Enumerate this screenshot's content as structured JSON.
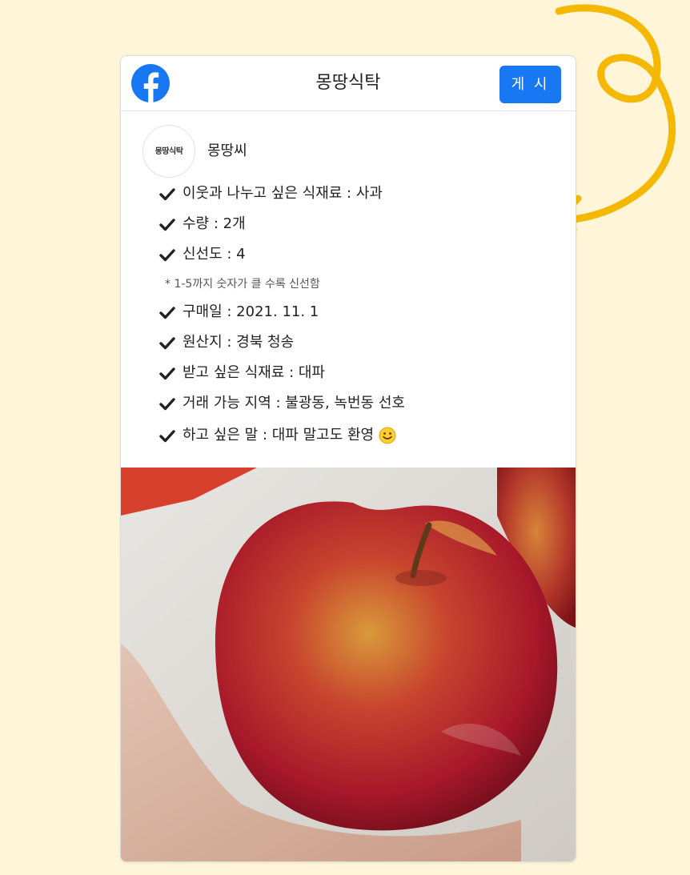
{
  "header": {
    "title": "몽땅식탁",
    "post_button_label": "게 시",
    "logo_icon": "facebook-icon"
  },
  "profile": {
    "avatar_text": "몽땅식탁",
    "name": "몽땅씨"
  },
  "details": [
    "이웃과 나누고 싶은 식재료 : 사과",
    "수량 : 2개",
    "신선도 : 4",
    "구매일 : 2021. 11. 1",
    "원산지 : 경북 청송",
    "받고 싶은 식재료 : 대파",
    "거래 가능 지역 : 불광동, 녹번동 선호",
    "하고 싶은 말 : 대파 말고도 환영"
  ],
  "freshness_note": "* 1-5까지 숫자가 클 수록 신선함",
  "colors": {
    "background": "#fff5d9",
    "accent_button": "#1877f2",
    "arrow": "#f5b800"
  },
  "icons": {
    "check": "check-icon",
    "smile": "smile-emoji-icon"
  }
}
